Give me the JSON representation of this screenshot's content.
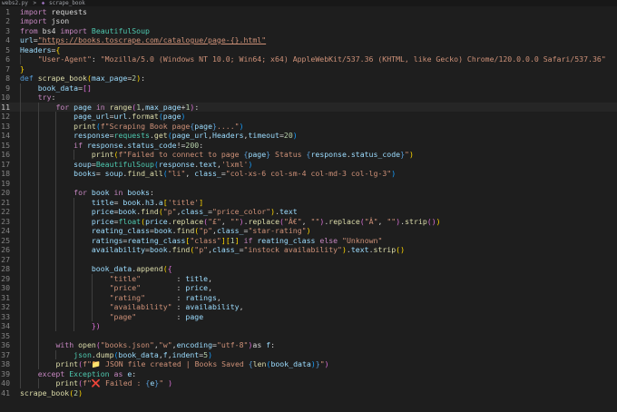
{
  "tab": {
    "label": "webs2.py",
    "breadcrumb_sep": ">",
    "symbol": "scrape_book"
  },
  "current_line": 11,
  "lines": [
    [
      {
        "t": "import",
        "c": "kw"
      },
      {
        "t": " requests"
      }
    ],
    [
      {
        "t": "import",
        "c": "kw"
      },
      {
        "t": " json"
      }
    ],
    [
      {
        "t": "from",
        "c": "kw"
      },
      {
        "t": " bs4 "
      },
      {
        "t": "import",
        "c": "kw"
      },
      {
        "t": " "
      },
      {
        "t": "BeautifulSoup",
        "c": "cl"
      }
    ],
    [
      {
        "t": "url",
        "c": "vr"
      },
      {
        "t": "="
      },
      {
        "t": "\"https://books.toscrape.com/catalogue/page-{}.html\"",
        "c": "st ul"
      }
    ],
    [
      {
        "t": "Headers",
        "c": "vr"
      },
      {
        "t": "="
      },
      {
        "t": "{",
        "c": "br"
      }
    ],
    [
      {
        "t": "    "
      },
      {
        "t": "\"User-Agent\"",
        "c": "st"
      },
      {
        "t": ": "
      },
      {
        "t": "\"Mozilla/5.0 (Windows NT 10.0; Win64; x64) AppleWebKit/537.36 (KHTML, like Gecko) Chrome/120.0.0.0 Safari/537.36\"",
        "c": "st"
      }
    ],
    [
      {
        "t": "}",
        "c": "br"
      }
    ],
    [
      {
        "t": "def",
        "c": "kb"
      },
      {
        "t": " "
      },
      {
        "t": "scrape_book",
        "c": "fn"
      },
      {
        "t": "(",
        "c": "br"
      },
      {
        "t": "max_page",
        "c": "vr"
      },
      {
        "t": "="
      },
      {
        "t": "2",
        "c": "nu"
      },
      {
        "t": ")",
        "c": "br"
      },
      {
        "t": ":"
      }
    ],
    [
      {
        "t": "    "
      },
      {
        "t": "book_data",
        "c": "vr"
      },
      {
        "t": "="
      },
      {
        "t": "[]",
        "c": "br2"
      }
    ],
    [
      {
        "t": "    "
      },
      {
        "t": "try",
        "c": "kw"
      },
      {
        "t": ":"
      }
    ],
    [
      {
        "t": "        "
      },
      {
        "t": "for",
        "c": "kw"
      },
      {
        "t": " "
      },
      {
        "t": "page",
        "c": "vr"
      },
      {
        "t": " "
      },
      {
        "t": "in",
        "c": "kw"
      },
      {
        "t": " "
      },
      {
        "t": "range",
        "c": "fn"
      },
      {
        "t": "(",
        "c": "br2"
      },
      {
        "t": "1",
        "c": "nu"
      },
      {
        "t": ","
      },
      {
        "t": "max_page",
        "c": "vr"
      },
      {
        "t": "+"
      },
      {
        "t": "1",
        "c": "nu"
      },
      {
        "t": ")",
        "c": "br2"
      },
      {
        "t": ":"
      }
    ],
    [
      {
        "t": "            "
      },
      {
        "t": "page_url",
        "c": "vr"
      },
      {
        "t": "="
      },
      {
        "t": "url",
        "c": "vr"
      },
      {
        "t": "."
      },
      {
        "t": "format",
        "c": "fn"
      },
      {
        "t": "(",
        "c": "br3"
      },
      {
        "t": "page",
        "c": "vr"
      },
      {
        "t": ")",
        "c": "br3"
      }
    ],
    [
      {
        "t": "            "
      },
      {
        "t": "print",
        "c": "fn"
      },
      {
        "t": "(",
        "c": "br3"
      },
      {
        "t": "f\"Scraping Book page",
        "c": "st"
      },
      {
        "t": "{",
        "c": "kb"
      },
      {
        "t": "page",
        "c": "vr"
      },
      {
        "t": "}",
        "c": "kb"
      },
      {
        "t": "....\"",
        "c": "st"
      },
      {
        "t": ")",
        "c": "br3"
      }
    ],
    [
      {
        "t": "            "
      },
      {
        "t": "response",
        "c": "vr"
      },
      {
        "t": "="
      },
      {
        "t": "requests",
        "c": "cl"
      },
      {
        "t": "."
      },
      {
        "t": "get",
        "c": "fn"
      },
      {
        "t": "(",
        "c": "br3"
      },
      {
        "t": "page_url",
        "c": "vr"
      },
      {
        "t": ","
      },
      {
        "t": "Headers",
        "c": "vr"
      },
      {
        "t": ","
      },
      {
        "t": "timeout",
        "c": "vr"
      },
      {
        "t": "="
      },
      {
        "t": "20",
        "c": "nu"
      },
      {
        "t": ")",
        "c": "br3"
      }
    ],
    [
      {
        "t": "            "
      },
      {
        "t": "if",
        "c": "kw"
      },
      {
        "t": " "
      },
      {
        "t": "response",
        "c": "vr"
      },
      {
        "t": "."
      },
      {
        "t": "status_code",
        "c": "vr"
      },
      {
        "t": "!="
      },
      {
        "t": "200",
        "c": "nu"
      },
      {
        "t": ":"
      }
    ],
    [
      {
        "t": "                "
      },
      {
        "t": "print",
        "c": "fn"
      },
      {
        "t": "(",
        "c": "br"
      },
      {
        "t": "f\"Failed to connect to page ",
        "c": "st"
      },
      {
        "t": "{",
        "c": "kb"
      },
      {
        "t": "page",
        "c": "vr"
      },
      {
        "t": "}",
        "c": "kb"
      },
      {
        "t": " Status ",
        "c": "st"
      },
      {
        "t": "{",
        "c": "kb"
      },
      {
        "t": "response",
        "c": "vr"
      },
      {
        "t": "."
      },
      {
        "t": "status_code",
        "c": "vr"
      },
      {
        "t": "}",
        "c": "kb"
      },
      {
        "t": "\"",
        "c": "st"
      },
      {
        "t": ")",
        "c": "br"
      }
    ],
    [
      {
        "t": "            "
      },
      {
        "t": "soup",
        "c": "vr"
      },
      {
        "t": "="
      },
      {
        "t": "BeautifulSoup",
        "c": "cl"
      },
      {
        "t": "(",
        "c": "br3"
      },
      {
        "t": "response",
        "c": "vr"
      },
      {
        "t": "."
      },
      {
        "t": "text",
        "c": "vr"
      },
      {
        "t": ","
      },
      {
        "t": "'lxml'",
        "c": "st"
      },
      {
        "t": ")",
        "c": "br3"
      }
    ],
    [
      {
        "t": "            "
      },
      {
        "t": "books",
        "c": "vr"
      },
      {
        "t": "= "
      },
      {
        "t": "soup",
        "c": "vr"
      },
      {
        "t": "."
      },
      {
        "t": "find_all",
        "c": "fn"
      },
      {
        "t": "(",
        "c": "br3"
      },
      {
        "t": "\"li\"",
        "c": "st"
      },
      {
        "t": ", "
      },
      {
        "t": "class_",
        "c": "vr"
      },
      {
        "t": "="
      },
      {
        "t": "\"col-xs-6 col-sm-4 col-md-3 col-lg-3\"",
        "c": "st"
      },
      {
        "t": ")",
        "c": "br3"
      }
    ],
    [],
    [
      {
        "t": "            "
      },
      {
        "t": "for",
        "c": "kw"
      },
      {
        "t": " "
      },
      {
        "t": "book",
        "c": "vr"
      },
      {
        "t": " "
      },
      {
        "t": "in",
        "c": "kw"
      },
      {
        "t": " "
      },
      {
        "t": "books",
        "c": "vr"
      },
      {
        "t": ":"
      }
    ],
    [
      {
        "t": "                "
      },
      {
        "t": "title",
        "c": "vr"
      },
      {
        "t": "= "
      },
      {
        "t": "book",
        "c": "vr"
      },
      {
        "t": "."
      },
      {
        "t": "h3",
        "c": "vr"
      },
      {
        "t": "."
      },
      {
        "t": "a",
        "c": "vr"
      },
      {
        "t": "[",
        "c": "br"
      },
      {
        "t": "'title'",
        "c": "st"
      },
      {
        "t": "]",
        "c": "br"
      }
    ],
    [
      {
        "t": "                "
      },
      {
        "t": "price",
        "c": "vr"
      },
      {
        "t": "="
      },
      {
        "t": "book",
        "c": "vr"
      },
      {
        "t": "."
      },
      {
        "t": "find",
        "c": "fn"
      },
      {
        "t": "(",
        "c": "br"
      },
      {
        "t": "\"p\"",
        "c": "st"
      },
      {
        "t": ","
      },
      {
        "t": "class_",
        "c": "vr"
      },
      {
        "t": "="
      },
      {
        "t": "\"price_color\"",
        "c": "st"
      },
      {
        "t": ")",
        "c": "br"
      },
      {
        "t": "."
      },
      {
        "t": "text",
        "c": "vr"
      }
    ],
    [
      {
        "t": "                "
      },
      {
        "t": "price",
        "c": "vr"
      },
      {
        "t": "="
      },
      {
        "t": "float",
        "c": "cl"
      },
      {
        "t": "(",
        "c": "br"
      },
      {
        "t": "price",
        "c": "vr"
      },
      {
        "t": "."
      },
      {
        "t": "replace",
        "c": "fn"
      },
      {
        "t": "(",
        "c": "br2"
      },
      {
        "t": "\"£\"",
        "c": "st"
      },
      {
        "t": ", "
      },
      {
        "t": "\"\"",
        "c": "st"
      },
      {
        "t": ")",
        "c": "br2"
      },
      {
        "t": "."
      },
      {
        "t": "replace",
        "c": "fn"
      },
      {
        "t": "(",
        "c": "br2"
      },
      {
        "t": "\"Â€\"",
        "c": "st"
      },
      {
        "t": ", "
      },
      {
        "t": "\"\"",
        "c": "st"
      },
      {
        "t": ")",
        "c": "br2"
      },
      {
        "t": "."
      },
      {
        "t": "replace",
        "c": "fn"
      },
      {
        "t": "(",
        "c": "br2"
      },
      {
        "t": "\"Â\"",
        "c": "st"
      },
      {
        "t": ", "
      },
      {
        "t": "\"\"",
        "c": "st"
      },
      {
        "t": ")",
        "c": "br2"
      },
      {
        "t": "."
      },
      {
        "t": "strip",
        "c": "fn"
      },
      {
        "t": "()",
        "c": "br2"
      },
      {
        "t": ")",
        "c": "br"
      }
    ],
    [
      {
        "t": "                "
      },
      {
        "t": "reating_class",
        "c": "vr"
      },
      {
        "t": "="
      },
      {
        "t": "book",
        "c": "vr"
      },
      {
        "t": "."
      },
      {
        "t": "find",
        "c": "fn"
      },
      {
        "t": "(",
        "c": "br"
      },
      {
        "t": "\"p\"",
        "c": "st"
      },
      {
        "t": ","
      },
      {
        "t": "class_",
        "c": "vr"
      },
      {
        "t": "="
      },
      {
        "t": "\"star-rating\"",
        "c": "st"
      },
      {
        "t": ")",
        "c": "br"
      }
    ],
    [
      {
        "t": "                "
      },
      {
        "t": "ratings",
        "c": "vr"
      },
      {
        "t": "="
      },
      {
        "t": "reating_class",
        "c": "vr"
      },
      {
        "t": "[",
        "c": "br"
      },
      {
        "t": "\"class\"",
        "c": "st"
      },
      {
        "t": "]",
        "c": "br"
      },
      {
        "t": "[",
        "c": "br"
      },
      {
        "t": "1",
        "c": "nu"
      },
      {
        "t": "]",
        "c": "br"
      },
      {
        "t": " "
      },
      {
        "t": "if",
        "c": "kw"
      },
      {
        "t": " "
      },
      {
        "t": "reating_class",
        "c": "vr"
      },
      {
        "t": " "
      },
      {
        "t": "else",
        "c": "kw"
      },
      {
        "t": " "
      },
      {
        "t": "\"Unknown\"",
        "c": "st"
      }
    ],
    [
      {
        "t": "                "
      },
      {
        "t": "availability",
        "c": "vr"
      },
      {
        "t": "="
      },
      {
        "t": "book",
        "c": "vr"
      },
      {
        "t": "."
      },
      {
        "t": "find",
        "c": "fn"
      },
      {
        "t": "(",
        "c": "br"
      },
      {
        "t": "\"p\"",
        "c": "st"
      },
      {
        "t": ","
      },
      {
        "t": "class_",
        "c": "vr"
      },
      {
        "t": "="
      },
      {
        "t": "\"instock availability\"",
        "c": "st"
      },
      {
        "t": ")",
        "c": "br"
      },
      {
        "t": "."
      },
      {
        "t": "text",
        "c": "vr"
      },
      {
        "t": "."
      },
      {
        "t": "strip",
        "c": "fn"
      },
      {
        "t": "()",
        "c": "br"
      }
    ],
    [],
    [
      {
        "t": "                "
      },
      {
        "t": "book_data",
        "c": "vr"
      },
      {
        "t": "."
      },
      {
        "t": "append",
        "c": "fn"
      },
      {
        "t": "(",
        "c": "br"
      },
      {
        "t": "{",
        "c": "br2"
      }
    ],
    [
      {
        "t": "                    "
      },
      {
        "t": "\"title\"",
        "c": "st"
      },
      {
        "t": "        : "
      },
      {
        "t": "title",
        "c": "vr"
      },
      {
        "t": ","
      }
    ],
    [
      {
        "t": "                    "
      },
      {
        "t": "\"price\"",
        "c": "st"
      },
      {
        "t": "        : "
      },
      {
        "t": "price",
        "c": "vr"
      },
      {
        "t": ","
      }
    ],
    [
      {
        "t": "                    "
      },
      {
        "t": "\"rating\"",
        "c": "st"
      },
      {
        "t": "       : "
      },
      {
        "t": "ratings",
        "c": "vr"
      },
      {
        "t": ","
      }
    ],
    [
      {
        "t": "                    "
      },
      {
        "t": "\"availability\"",
        "c": "st"
      },
      {
        "t": " : "
      },
      {
        "t": "availability",
        "c": "vr"
      },
      {
        "t": ","
      }
    ],
    [
      {
        "t": "                    "
      },
      {
        "t": "\"page\"",
        "c": "st"
      },
      {
        "t": "         : "
      },
      {
        "t": "page",
        "c": "vr"
      }
    ],
    [
      {
        "t": "                "
      },
      {
        "t": "})",
        "c": "br2"
      }
    ],
    [],
    [
      {
        "t": "        "
      },
      {
        "t": "with",
        "c": "kw"
      },
      {
        "t": " "
      },
      {
        "t": "open",
        "c": "fn"
      },
      {
        "t": "(",
        "c": "br2"
      },
      {
        "t": "\"books.json\"",
        "c": "st"
      },
      {
        "t": ","
      },
      {
        "t": "\"w\"",
        "c": "st"
      },
      {
        "t": ","
      },
      {
        "t": "encoding",
        "c": "vr"
      },
      {
        "t": "="
      },
      {
        "t": "\"utf-8\"",
        "c": "st"
      },
      {
        "t": ")",
        "c": "br2"
      },
      {
        "t": "as "
      },
      {
        "t": "f",
        "c": "vr"
      },
      {
        "t": ":"
      }
    ],
    [
      {
        "t": "            "
      },
      {
        "t": "json",
        "c": "cl"
      },
      {
        "t": "."
      },
      {
        "t": "dump",
        "c": "fn"
      },
      {
        "t": "(",
        "c": "br3"
      },
      {
        "t": "book_data",
        "c": "vr"
      },
      {
        "t": ","
      },
      {
        "t": "f",
        "c": "vr"
      },
      {
        "t": ","
      },
      {
        "t": "indent",
        "c": "vr"
      },
      {
        "t": "="
      },
      {
        "t": "5",
        "c": "nu"
      },
      {
        "t": ")",
        "c": "br3"
      }
    ],
    [
      {
        "t": "        "
      },
      {
        "t": "print",
        "c": "fn"
      },
      {
        "t": "(",
        "c": "br2"
      },
      {
        "t": "f\"",
        "c": "st"
      },
      {
        "t": "📁",
        "c": "emo"
      },
      {
        "t": " JSON file created | Books Saved ",
        "c": "st"
      },
      {
        "t": "{",
        "c": "kb"
      },
      {
        "t": "len",
        "c": "fn"
      },
      {
        "t": "(",
        "c": "br3"
      },
      {
        "t": "book_data",
        "c": "vr"
      },
      {
        "t": ")",
        "c": "br3"
      },
      {
        "t": "}",
        "c": "kb"
      },
      {
        "t": "\"",
        "c": "st"
      },
      {
        "t": ")",
        "c": "br2"
      }
    ],
    [
      {
        "t": "    "
      },
      {
        "t": "except",
        "c": "kw"
      },
      {
        "t": " "
      },
      {
        "t": "Exception",
        "c": "cl"
      },
      {
        "t": " "
      },
      {
        "t": "as",
        "c": "kw"
      },
      {
        "t": " "
      },
      {
        "t": "e",
        "c": "vr"
      },
      {
        "t": ":"
      }
    ],
    [
      {
        "t": "        "
      },
      {
        "t": "print",
        "c": "fn"
      },
      {
        "t": "(",
        "c": "br2"
      },
      {
        "t": "f\"",
        "c": "st"
      },
      {
        "t": "❌",
        "c": "emo-x"
      },
      {
        "t": " Failed : ",
        "c": "st"
      },
      {
        "t": "{",
        "c": "kb"
      },
      {
        "t": "e",
        "c": "vr"
      },
      {
        "t": "}",
        "c": "kb"
      },
      {
        "t": "\" ",
        "c": "st"
      },
      {
        "t": ")",
        "c": "br2"
      }
    ],
    [
      {
        "t": "scrape_book",
        "c": "fn"
      },
      {
        "t": "(",
        "c": "br"
      },
      {
        "t": "2",
        "c": "nu"
      },
      {
        "t": ")",
        "c": "br"
      }
    ]
  ],
  "indent_guides": [
    [],
    [],
    [],
    [],
    [],
    [
      1
    ],
    [],
    [],
    [
      1
    ],
    [
      1
    ],
    [
      1,
      2
    ],
    [
      1,
      2,
      3
    ],
    [
      1,
      2,
      3
    ],
    [
      1,
      2,
      3
    ],
    [
      1,
      2,
      3
    ],
    [
      1,
      2,
      3,
      4
    ],
    [
      1,
      2,
      3
    ],
    [
      1,
      2,
      3
    ],
    [
      1,
      2,
      3
    ],
    [
      1,
      2,
      3
    ],
    [
      1,
      2,
      3,
      4
    ],
    [
      1,
      2,
      3,
      4
    ],
    [
      1,
      2,
      3,
      4
    ],
    [
      1,
      2,
      3,
      4
    ],
    [
      1,
      2,
      3,
      4
    ],
    [
      1,
      2,
      3,
      4
    ],
    [
      1,
      2,
      3,
      4
    ],
    [
      1,
      2,
      3,
      4
    ],
    [
      1,
      2,
      3,
      4,
      5
    ],
    [
      1,
      2,
      3,
      4,
      5
    ],
    [
      1,
      2,
      3,
      4,
      5
    ],
    [
      1,
      2,
      3,
      4,
      5
    ],
    [
      1,
      2,
      3,
      4,
      5
    ],
    [
      1,
      2,
      3,
      4
    ],
    [
      1,
      2
    ],
    [
      1,
      2
    ],
    [
      1,
      2,
      3
    ],
    [
      1,
      2
    ],
    [
      1
    ],
    [
      1,
      2
    ],
    []
  ]
}
